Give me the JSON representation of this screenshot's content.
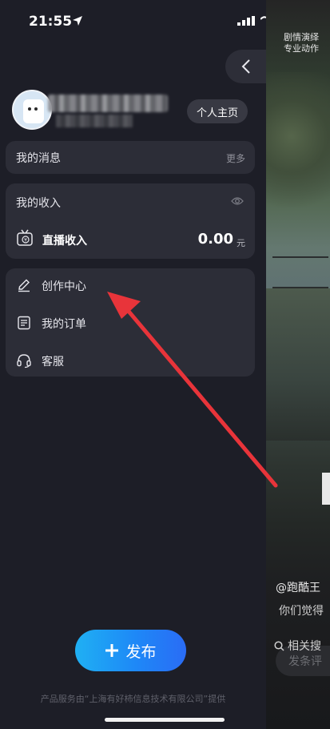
{
  "status_bar": {
    "time": "21:55"
  },
  "background": {
    "drama_line1": "剧情演绎",
    "drama_line2": "专业动作",
    "author": "@跑酷王",
    "caption": "你们觉得",
    "related": "相关搜",
    "comment_placeholder": "发条评"
  },
  "profile": {
    "homepage_button": "个人主页"
  },
  "messages": {
    "title": "我的消息",
    "more": "更多"
  },
  "income": {
    "title": "我的收入",
    "live_label": "直播收入",
    "amount": "0.00",
    "unit": "元"
  },
  "menu": {
    "items": [
      {
        "label": "创作中心",
        "icon": "pencil-icon"
      },
      {
        "label": "我的订单",
        "icon": "order-list-icon"
      },
      {
        "label": "客服",
        "icon": "headset-icon"
      }
    ]
  },
  "publish": {
    "label": "发布"
  },
  "footer": "产品服务由“上海有好柿信息技术有限公司”提供",
  "colors": {
    "accent": "#1e88f7",
    "arrow": "#e8343a",
    "panel_bg": "#1d1e27",
    "card_bg": "#2c2d37"
  }
}
